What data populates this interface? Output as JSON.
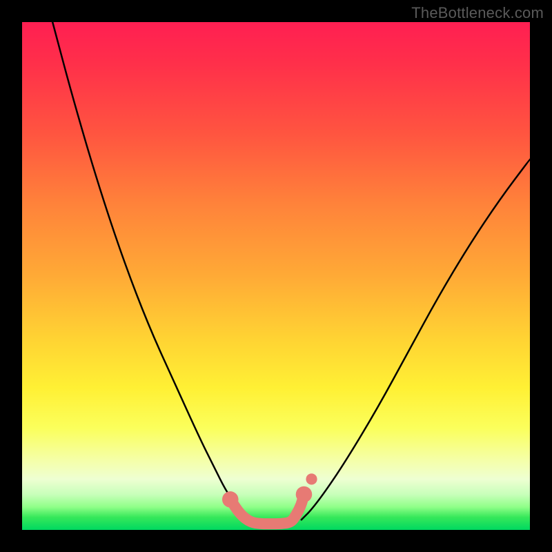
{
  "watermark": "TheBottleneck.com",
  "chart_data": {
    "type": "line",
    "title": "",
    "xlabel": "",
    "ylabel": "",
    "xlim": [
      0,
      100
    ],
    "ylim": [
      0,
      100
    ],
    "grid": false,
    "legend": false,
    "series": [
      {
        "name": "left-curve",
        "color": "#000000",
        "x": [
          6,
          10,
          15,
          20,
          25,
          30,
          35,
          38,
          40,
          42,
          44,
          45
        ],
        "values": [
          100,
          85,
          68,
          53,
          40,
          29,
          18,
          12,
          8,
          5,
          3,
          2
        ]
      },
      {
        "name": "right-curve",
        "color": "#000000",
        "x": [
          55,
          57,
          60,
          64,
          70,
          76,
          82,
          88,
          94,
          100
        ],
        "values": [
          2,
          4,
          8,
          14,
          24,
          35,
          46,
          56,
          65,
          73
        ]
      },
      {
        "name": "salmon-trough",
        "color": "#e77a74",
        "x": [
          41,
          43,
          45,
          47,
          49,
          51,
          53,
          54,
          55,
          55.5
        ],
        "values": [
          6,
          3,
          1.5,
          1.2,
          1.2,
          1.2,
          1.5,
          3,
          5,
          7
        ]
      }
    ],
    "markers": [
      {
        "x": 41,
        "y": 6,
        "r": 1.6,
        "color": "#e77a74",
        "name": "trough-endpoint-left"
      },
      {
        "x": 55.5,
        "y": 7,
        "r": 1.6,
        "color": "#e77a74",
        "name": "trough-endpoint-right"
      },
      {
        "x": 57,
        "y": 10,
        "r": 1.1,
        "color": "#e77a74",
        "name": "upper-dot"
      }
    ]
  }
}
